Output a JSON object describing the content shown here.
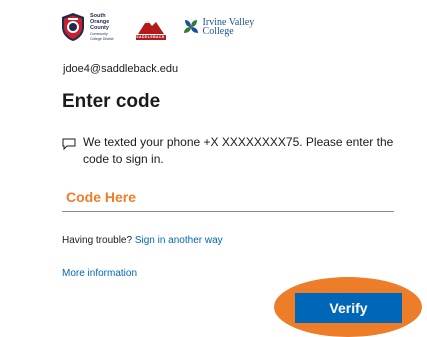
{
  "logos": {
    "socccd": {
      "lines": [
        "South",
        "Orange",
        "County"
      ],
      "sub_lines": [
        "Community",
        "College District"
      ]
    },
    "saddleback": {
      "band_text": "SADDLEBACK"
    },
    "ivc": {
      "lines": [
        "Irvine Valley",
        "College"
      ]
    }
  },
  "account": {
    "email": "jdoe4@saddleback.edu"
  },
  "heading": "Enter code",
  "message": "We texted your phone +X XXXXXXXX75. Please enter the code to sign in.",
  "code_field": {
    "value": "Code Here"
  },
  "help": {
    "trouble_text": "Having trouble?",
    "trouble_link": "Sign in another way",
    "more_info_link": "More information"
  },
  "actions": {
    "verify_label": "Verify"
  },
  "colors": {
    "accent_blue": "#0067b8",
    "highlight_orange": "#ee7d29",
    "code_text_orange": "#f07c2a"
  },
  "icons": {
    "message": "chat-bubble-icon"
  }
}
